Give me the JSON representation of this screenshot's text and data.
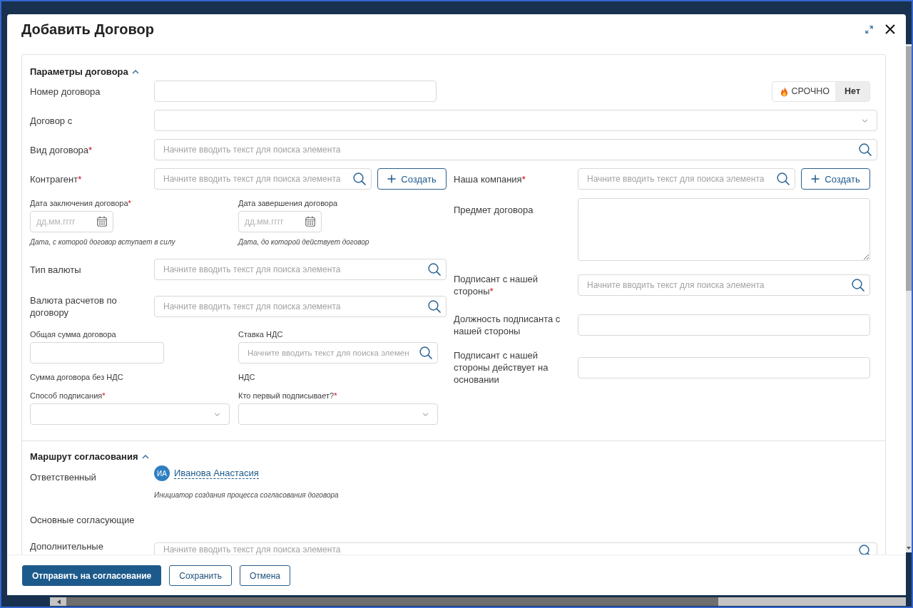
{
  "dialog": {
    "title": "Добавить Договор"
  },
  "contract_parameters": {
    "title": "Параметры договора",
    "expanded": true,
    "top_fields": [
      {
        "kind": "text",
        "label": "Номер договора",
        "urgent": {
          "label": "СРОЧНО",
          "value": "Нет",
          "on": false
        }
      },
      {
        "kind": "select",
        "label": "Договор с"
      },
      {
        "kind": "search",
        "label": "Вид договора",
        "required_mark": "*",
        "placeholder": "Начните вводить текст для поиска элемента"
      }
    ],
    "left_column": [
      {
        "kind": "search-create",
        "label": "Контрагент",
        "required_mark": "*",
        "placeholder": "Начните вводить текст для поиска элемента",
        "button": "Создать"
      },
      {
        "kind": "pair",
        "items": [
          {
            "kind": "date",
            "label": "Дата заключения договора",
            "required_mark": "*",
            "placeholder": "дд.мм.гггг",
            "hint": "Дата, с которой договор вступает в силу"
          },
          {
            "kind": "date",
            "label": "Дата завершения договора",
            "placeholder": "дд.мм.гггг",
            "hint": "Дата, до которой действует договор"
          }
        ]
      },
      {
        "kind": "search",
        "label": "Тип валюты",
        "placeholder": "Начните вводить текст для поиска элемента"
      },
      {
        "kind": "search",
        "label": "Валюта расчетов по договору",
        "placeholder": "Начните вводить текст для поиска элемента"
      },
      {
        "kind": "pair",
        "items": [
          {
            "kind": "amount",
            "label": "Общая сумма договора"
          },
          {
            "kind": "search",
            "label": "Ставка НДС",
            "placeholder": "Начните вводить текст для поиска элемен"
          }
        ]
      },
      {
        "kind": "pair",
        "items": [
          {
            "kind": "readout",
            "label": "Сумма договора без НДС"
          },
          {
            "kind": "readout",
            "label": "НДС"
          }
        ]
      },
      {
        "kind": "pair",
        "items": [
          {
            "kind": "select",
            "label": "Способ подписания",
            "required_mark": "*"
          },
          {
            "kind": "select",
            "label": "Кто первый подписывает?",
            "required_mark": "*"
          }
        ]
      }
    ],
    "right_column": [
      {
        "kind": "search-create",
        "label": "Наша компания",
        "required_mark": "*",
        "placeholder": "Начните вводить текст для поиска элемента",
        "button": "Создать"
      },
      {
        "kind": "textarea",
        "label": "Предмет договора"
      },
      {
        "kind": "search",
        "label": "Подписант с нашей стороны",
        "required_mark": "*",
        "placeholder": "Начните вводить текст для поиска элемента"
      },
      {
        "kind": "text",
        "label": "Должность подписанта с нашей стороны"
      },
      {
        "kind": "text",
        "label": "Подписант с нашей стороны действует на основании"
      }
    ]
  },
  "approval_route": {
    "title": "Маршрут согласования",
    "expanded": true,
    "rows": [
      {
        "kind": "user",
        "label": "Ответственный",
        "initials": "ИА",
        "name": "Иванова Анастасия",
        "hint": "Инициатор создания процесса согласования договора"
      },
      {
        "kind": "readout",
        "label": "Основные согласующие"
      },
      {
        "kind": "search",
        "label": "Дополнительные",
        "placeholder": "Начните вводить текст для поиска элемента"
      }
    ]
  },
  "footer": {
    "buttons": [
      {
        "label": "Отправить на согласование",
        "kind": "primary"
      },
      {
        "label": "Сохранить",
        "kind": "secondary"
      },
      {
        "label": "Отмена",
        "kind": "secondary"
      }
    ]
  }
}
